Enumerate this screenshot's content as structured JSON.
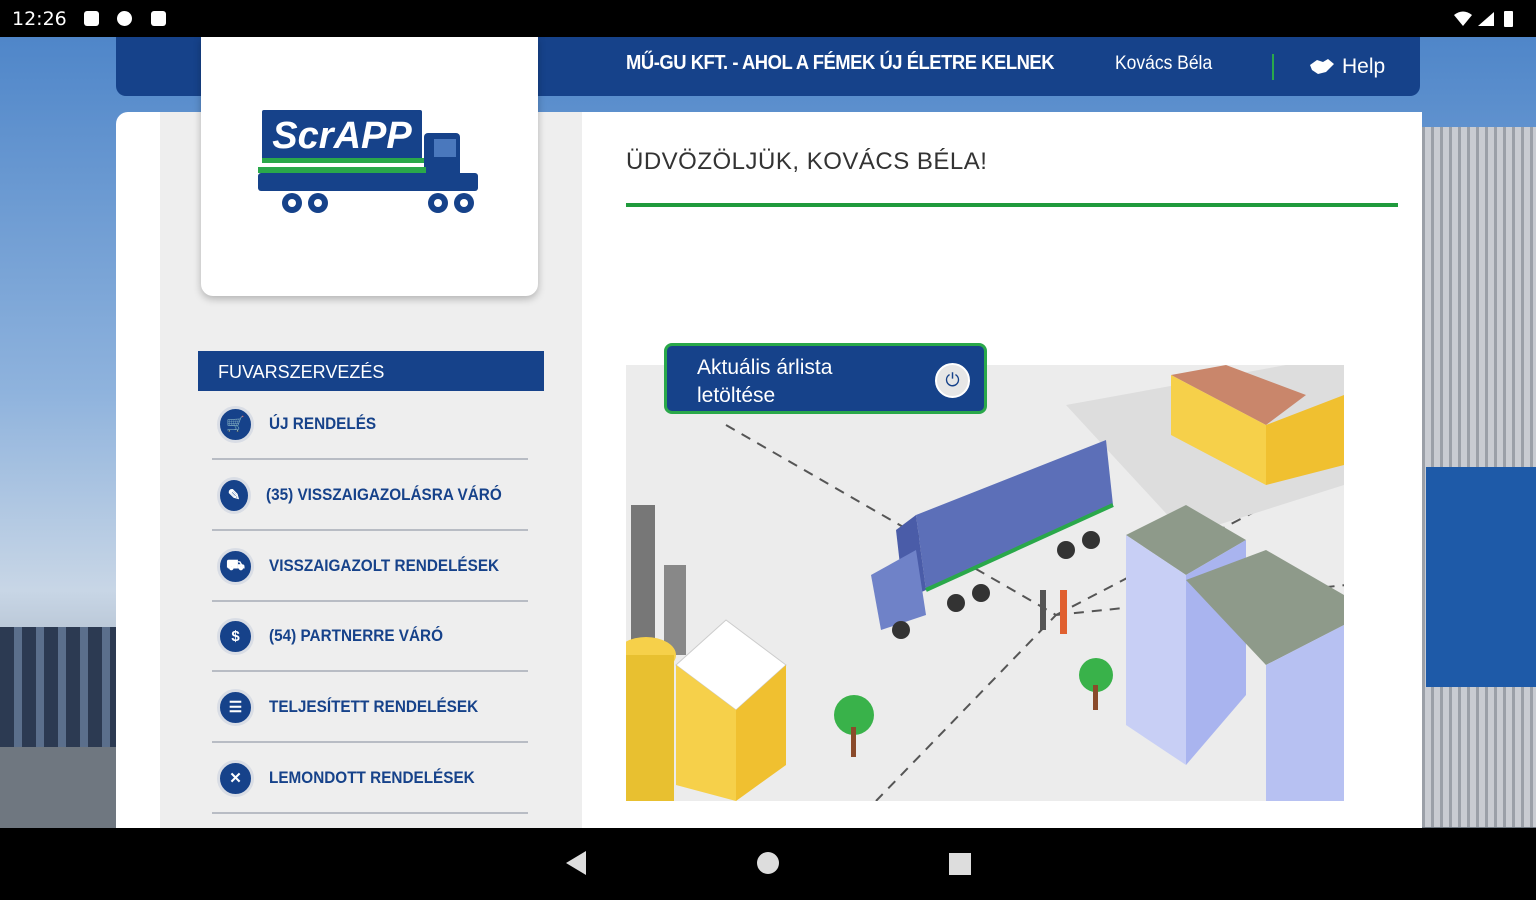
{
  "status_bar": {
    "time": "12:26"
  },
  "header": {
    "company": "MŰ-GU KFT. - AHOL A FÉMEK ÚJ ÉLETRE KELNEK",
    "user": "Kovács Béla",
    "help_label": "Help"
  },
  "logo": {
    "text": "ScrAPP"
  },
  "sidebar": {
    "section_title": "FUVARSZERVEZÉS",
    "items": [
      {
        "label": "ÚJ RENDELÉS",
        "icon": "cart-icon"
      },
      {
        "label": "(35) VISSZAIGAZOLÁSRA VÁRÓ",
        "icon": "edit-doc-icon"
      },
      {
        "label": "VISSZAIGAZOLT RENDELÉSEK",
        "icon": "truck-confirm-icon"
      },
      {
        "label": "(54) PARTNERRE VÁRÓ",
        "icon": "money-icon"
      },
      {
        "label": "TELJESÍTETT RENDELÉSEK",
        "icon": "list-icon"
      },
      {
        "label": "LEMONDOTT RENDELÉSEK",
        "icon": "cancel-icon"
      }
    ]
  },
  "main": {
    "welcome": "ÜDVÖZÖLJÜK, KOVÁCS BÉLA!",
    "download_button": {
      "line1": "Aktuális árlista",
      "line2": "letöltése"
    }
  },
  "colors": {
    "primary": "#16428a",
    "accent": "#2aa84a"
  }
}
